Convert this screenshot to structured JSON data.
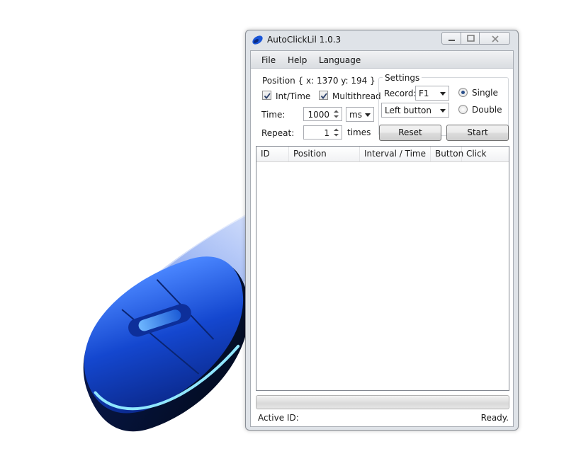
{
  "window": {
    "title": "AutoClickLil 1.0.3"
  },
  "menu": {
    "items": [
      "File",
      "Help",
      "Language"
    ]
  },
  "position": {
    "label": "Position { x: 1370 y: 194 }"
  },
  "options": {
    "int_time": {
      "label": "Int/Time",
      "checked": true
    },
    "multithread": {
      "label": "Multithread",
      "checked": true
    }
  },
  "time": {
    "label": "Time:",
    "value": "1000",
    "unit": "ms"
  },
  "repeat": {
    "label": "Repeat:",
    "value": "1",
    "unit": "times"
  },
  "settings": {
    "title": "Settings",
    "record_label": "Record:",
    "record_key": "F1",
    "mouse_button": "Left button",
    "single_label": "Single",
    "double_label": "Double",
    "selected_click": "single"
  },
  "buttons": {
    "reset": "Reset",
    "start": "Start"
  },
  "table": {
    "columns": [
      "ID",
      "Position",
      "Interval / Time",
      "Button",
      "Click"
    ],
    "rows": []
  },
  "progress": {
    "value": 0
  },
  "status": {
    "active_id_label": "Active ID:",
    "state": "Ready."
  },
  "colors": {
    "mouse_blue": "#1846c8",
    "window_frame": "#dfe3e8"
  }
}
